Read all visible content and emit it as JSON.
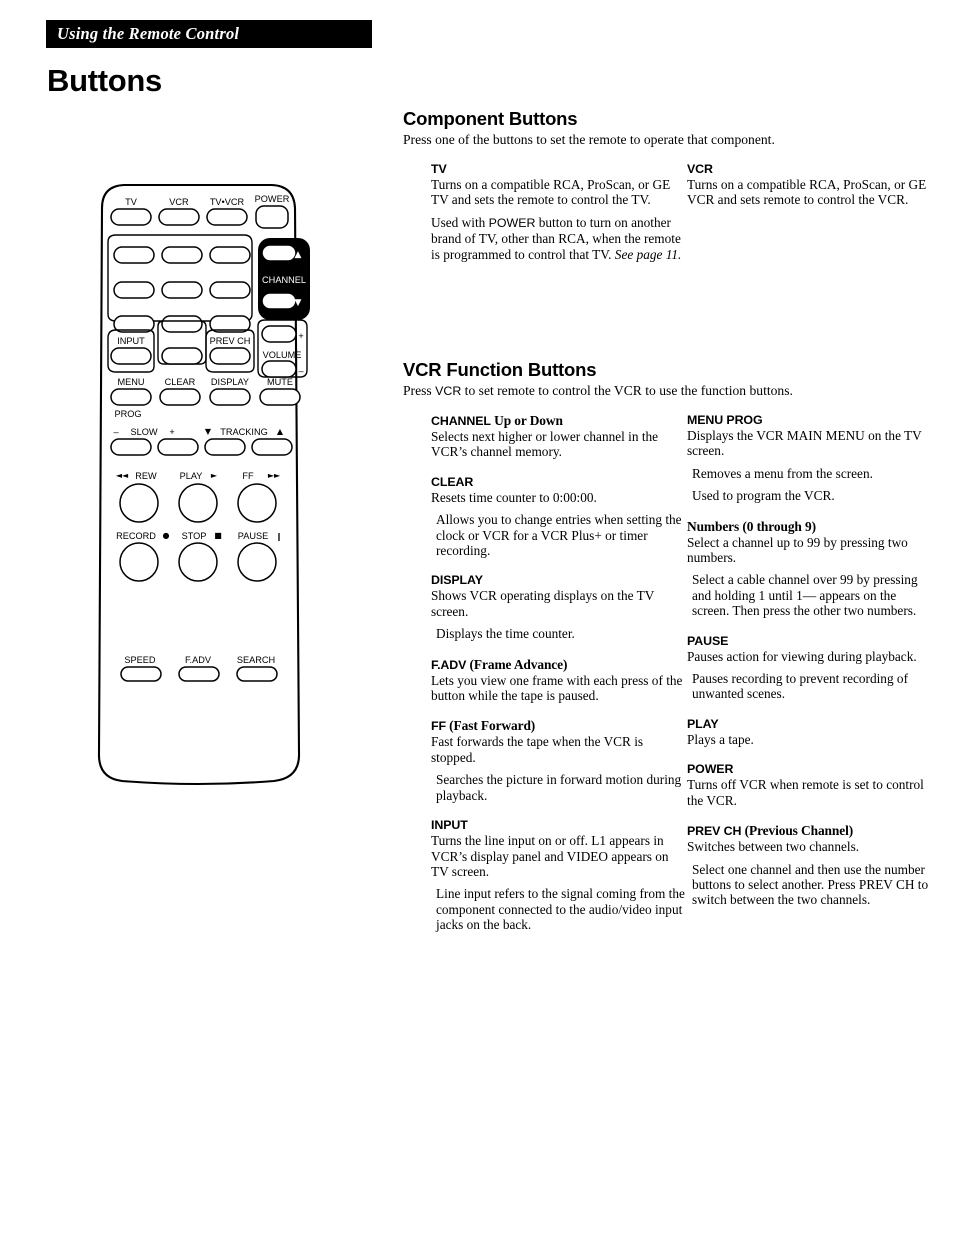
{
  "running_head": "Using the Remote Control",
  "page_title": "Buttons",
  "component_section": {
    "heading": "Component Buttons",
    "lead": "Press one of the buttons to set the remote to operate that component.",
    "left": {
      "term": "TV",
      "p1": "Turns on a compatible RCA, ProScan, or GE TV and sets the remote to control the TV.",
      "p2_a": "Used with ",
      "p2_b": "POWER",
      "p2_c": " button to turn on another brand of TV, other than RCA, when the remote is programmed to control that TV. ",
      "p2_ref": "See page 11."
    },
    "right": {
      "term": "VCR",
      "p1": "Turns on a compatible RCA, ProScan, or GE VCR and sets remote to control the VCR."
    }
  },
  "vcr_section": {
    "heading": "VCR Function Buttons",
    "lead_a": "Press ",
    "lead_b": "VCR",
    "lead_c": " to set remote to control the VCR to use the function buttons.",
    "left_entries": [
      {
        "term_sans": "CHANNEL",
        "term_serif": " Up or Down",
        "paras": [
          "Selects next higher or lower channel in the VCR’s channel memory."
        ]
      },
      {
        "term_sans": "CLEAR",
        "term_serif": "",
        "paras": [
          "Resets time counter to 0:00:00.",
          "Allows you to change entries when setting the clock or VCR for a VCR Plus+ or timer recording."
        ]
      },
      {
        "term_sans": "DISPLAY",
        "term_serif": "",
        "paras": [
          "Shows VCR operating displays on the TV screen.",
          "Displays the time counter."
        ]
      },
      {
        "term_sans": "F.ADV",
        "term_serif": " (Frame Advance)",
        "paras": [
          "Lets you view one frame with each press of the button while the tape is paused."
        ]
      },
      {
        "term_sans": "FF",
        "term_serif": " (Fast Forward)",
        "paras": [
          "Fast forwards the tape when the VCR is stopped.",
          "Searches the picture in forward motion during playback."
        ]
      },
      {
        "term_sans": "INPUT",
        "term_serif": "",
        "paras": [
          "Turns the line input on or off. L1 appears in VCR’s display panel and VIDEO appears on TV screen.",
          "Line input refers to the signal coming from the component connected to the audio/video input jacks on the back."
        ]
      }
    ],
    "right_entries": [
      {
        "term_sans": "MENU PROG",
        "term_serif": "",
        "paras": [
          "Displays the VCR MAIN MENU on the TV screen.",
          "Removes a menu from the screen.",
          "Used to program the VCR."
        ]
      },
      {
        "term_sans": "",
        "term_serif": "Numbers (0 through 9)",
        "paras": [
          "Select a channel up to 99 by pressing two numbers.",
          "Select a cable channel over 99 by pressing and holding 1 until 1–– appears on the screen.  Then press the other two numbers."
        ]
      },
      {
        "term_sans": "PAUSE",
        "term_serif": "",
        "paras": [
          "Pauses action for viewing during playback.",
          "Pauses recording to prevent recording of unwanted scenes."
        ]
      },
      {
        "term_sans": "PLAY",
        "term_serif": "",
        "paras": [
          "Plays a tape."
        ]
      },
      {
        "term_sans": "POWER",
        "term_serif": "",
        "paras": [
          "Turns off VCR when remote is set to control the VCR."
        ]
      },
      {
        "term_sans": "PREV CH",
        "term_serif": " (Previous Channel)",
        "paras": [
          "Switches between two channels.",
          "Select one channel and then use the number buttons to select another.  Press PREV CH to switch between the two channels."
        ]
      }
    ]
  },
  "remote": {
    "labels": {
      "tv": "TV",
      "vcr": "VCR",
      "tv_vcr": "TV•VCR",
      "power": "POWER",
      "channel": "CHANNEL",
      "volume": "VOLUME",
      "input": "INPUT",
      "prev_ch": "PREV CH",
      "menu": "MENU",
      "prog": "PROG",
      "clear": "CLEAR",
      "display": "DISPLAY",
      "mute": "MUTE",
      "slow": "SLOW",
      "slow_minus": "–",
      "slow_plus": "+",
      "tracking": "TRACKING",
      "tracking_down": "▼",
      "tracking_up": "▲",
      "rew": "REW",
      "play": "PLAY",
      "ff": "FF",
      "record": "RECORD",
      "stop": "STOP",
      "pause": "PAUSE",
      "speed": "SPEED",
      "f_adv": "F.ADV",
      "search": "SEARCH",
      "vol_plus": "+",
      "vol_minus": "–",
      "chan_up": "▲",
      "chan_down": "▼",
      "rew_glyph": "◄◄",
      "play_glyph": "►",
      "ff_glyph": "►►",
      "record_glyph": "●",
      "stop_glyph": "■",
      "pause_glyph": "‖"
    },
    "colors": {
      "body_outline": "#000000",
      "channel_block": "#000000",
      "channel_text": "#ffffff"
    }
  }
}
